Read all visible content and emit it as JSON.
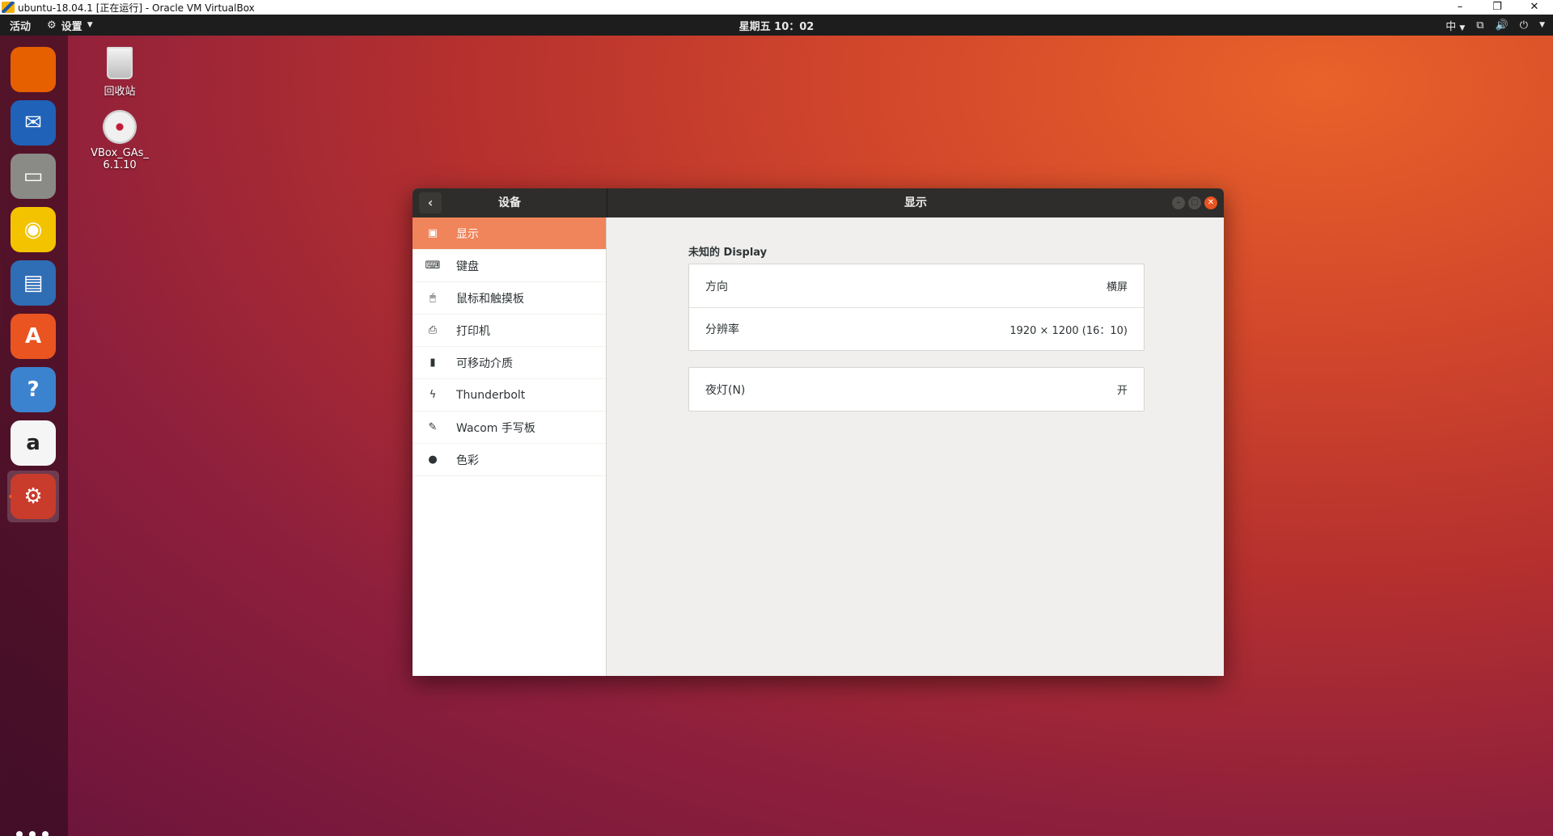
{
  "host": {
    "title": "ubuntu-18.04.1 [正在运行] - Oracle VM VirtualBox",
    "controls": [
      "–",
      "❐",
      "✕"
    ]
  },
  "topbar": {
    "activities": "活动",
    "app_menu": "设置",
    "clock": "星期五 10：02",
    "input_method": "中",
    "tray_icons": [
      "network-icon",
      "volume-icon",
      "power-icon"
    ]
  },
  "dock": {
    "apps": [
      {
        "name": "firefox",
        "glyph": "",
        "color": "#e66000"
      },
      {
        "name": "thunderbird",
        "glyph": "✉",
        "color": "#1f62b8"
      },
      {
        "name": "files",
        "glyph": "▭",
        "color": "#8a8a86"
      },
      {
        "name": "rhythmbox",
        "glyph": "◉",
        "color": "#f3c300"
      },
      {
        "name": "libreoffice-writer",
        "glyph": "▤",
        "color": "#2f6db5"
      },
      {
        "name": "ubuntu-software",
        "glyph": "A",
        "color": "#e95420"
      },
      {
        "name": "help",
        "glyph": "?",
        "color": "#3c83cf"
      },
      {
        "name": "amazon",
        "glyph": "a",
        "color": "#f5f5f5"
      },
      {
        "name": "settings",
        "glyph": "⚙",
        "color": "#c93b2b",
        "active": true
      }
    ]
  },
  "desktop": {
    "trash_label": "回收站",
    "disc_label_1": "VBox_GAs_",
    "disc_label_2": "6.1.10"
  },
  "window": {
    "sidebar_title": "设备",
    "main_title": "显示",
    "sidebar_items": [
      {
        "label": "显示",
        "icon": "display-icon",
        "glyph": "▣",
        "selected": true
      },
      {
        "label": "键盘",
        "icon": "keyboard-icon",
        "glyph": "⌨"
      },
      {
        "label": "鼠标和触摸板",
        "icon": "mouse-icon",
        "glyph": "🖱"
      },
      {
        "label": "打印机",
        "icon": "printer-icon",
        "glyph": "⎙"
      },
      {
        "label": "可移动介质",
        "icon": "removable-media-icon",
        "glyph": "▮"
      },
      {
        "label": "Thunderbolt",
        "icon": "thunderbolt-icon",
        "glyph": "ϟ"
      },
      {
        "label": "Wacom 手写板",
        "icon": "tablet-icon",
        "glyph": "✎"
      },
      {
        "label": "色彩",
        "icon": "color-icon",
        "glyph": "●"
      }
    ],
    "display": {
      "section_title": "未知的 Display",
      "orientation_label": "方向",
      "orientation_value": "横屏",
      "resolution_label": "分辨率",
      "resolution_value": "1920 × 1200 (16：10)",
      "night_light_label": "夜灯(N)",
      "night_light_value": "开"
    }
  }
}
